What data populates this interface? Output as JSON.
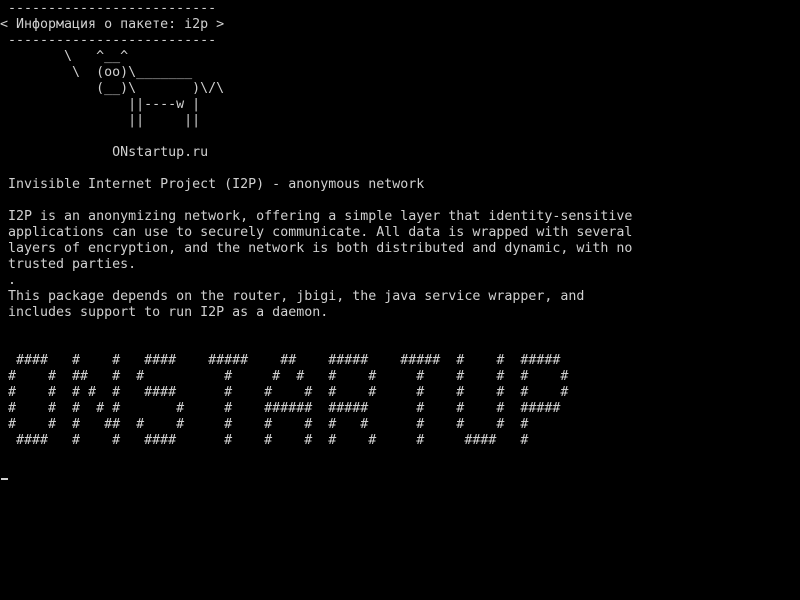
{
  "terminal": {
    "accent_color": "#d0d0d0",
    "background_color": "#000000",
    "lines": [
      " --------------------------",
      "< Информация о пакете: i2p >",
      " --------------------------",
      "        \\   ^__^",
      "         \\  (oo)\\_______",
      "            (__)\\       )\\/\\",
      "                ||----w |",
      "                ||     ||",
      "",
      "              ONstartup.ru",
      "",
      " Invisible Internet Project (I2P) - anonymous network",
      "",
      " I2P is an anonymizing network, offering a simple layer that identity-sensitive",
      " applications can use to securely communicate. All data is wrapped with several",
      " layers of encryption, and the network is both distributed and dynamic, with no",
      " trusted parties.",
      " .",
      " This package depends on the router, jbigi, the java service wrapper, and",
      " includes support to run I2P as a daemon.",
      "",
      "",
      "  ####   #    #   ####    #####    ##    #####    #####  #    #  #####",
      " #    #  ##   #  #          #     #  #   #    #     #    #    #  #    #",
      " #    #  # #  #   ####      #    #    #  #    #     #    #    #  #    #",
      " #    #  #  # #       #     #    ######  #####      #    #    #  #####",
      " #    #  #   ##  #    #     #    #    #  #   #      #    #    #  #",
      "  ####   #    #   ####      #    #    #  #    #     #     ####   #"
    ]
  }
}
